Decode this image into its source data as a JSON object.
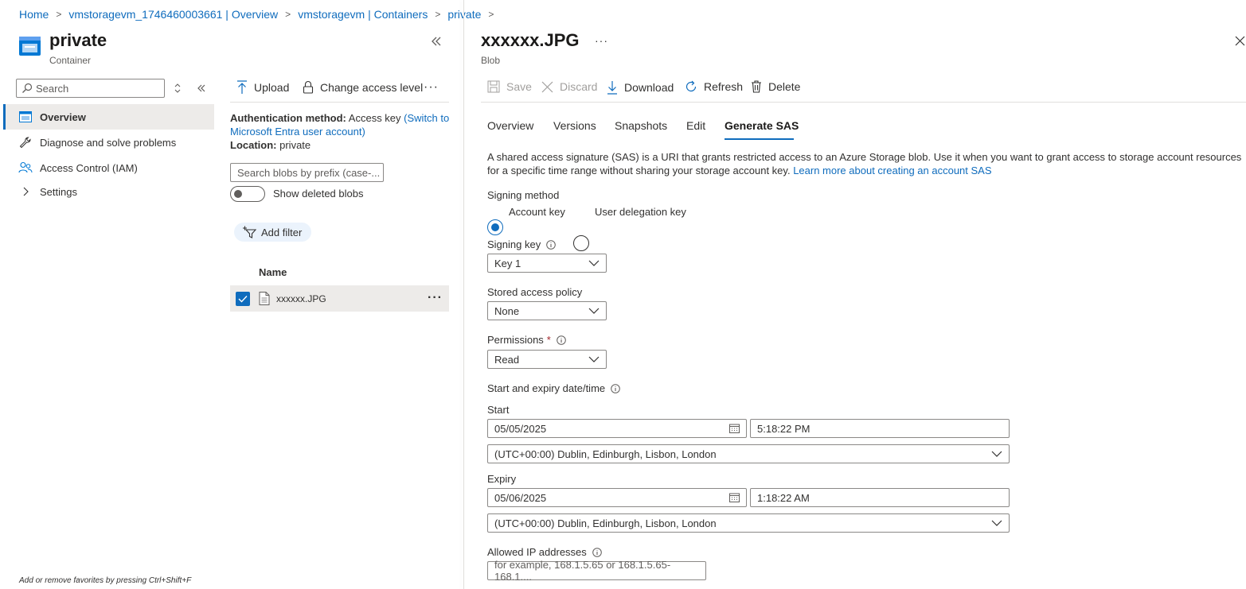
{
  "breadcrumb": [
    "Home",
    "vmstoragevm_1746460003661 | Overview",
    "vmstoragevm | Containers",
    "private"
  ],
  "left": {
    "title": "private",
    "subtitle": "Container",
    "search_placeholder": "Search",
    "nav": [
      {
        "label": "Overview",
        "icon": "overview-icon"
      },
      {
        "label": "Diagnose and solve problems",
        "icon": "wrench-icon"
      },
      {
        "label": "Access Control (IAM)",
        "icon": "people-icon"
      },
      {
        "label": "Settings",
        "icon": "chevron-right-icon"
      }
    ],
    "fav_hint": "Add or remove favorites by pressing Ctrl+Shift+F"
  },
  "middle": {
    "upload_label": "Upload",
    "change_access_label": "Change access level",
    "auth_label": "Authentication method:",
    "auth_value": "Access key",
    "auth_link": "(Switch to Microsoft Entra user account)",
    "location_label": "Location:",
    "location_value": "private",
    "blob_search_placeholder": "Search blobs by prefix (case-...",
    "show_deleted_label": "Show deleted blobs",
    "add_filter_label": "Add filter",
    "column_name": "Name",
    "rows": [
      {
        "name": "xxxxxx.JPG",
        "selected": true
      }
    ]
  },
  "right": {
    "title": "xxxxxx.JPG",
    "subtitle": "Blob",
    "toolbar": {
      "save": "Save",
      "discard": "Discard",
      "download": "Download",
      "refresh": "Refresh",
      "delete": "Delete"
    },
    "tabs": [
      "Overview",
      "Versions",
      "Snapshots",
      "Edit",
      "Generate SAS"
    ],
    "active_tab": "Generate SAS",
    "description": "A shared access signature (SAS) is a URI that grants restricted access to an Azure Storage blob. Use it when you want to grant access to storage account resources for a specific time range without sharing your storage account key.",
    "learn_more": "Learn more about creating an account SAS",
    "signing_method_label": "Signing method",
    "signing_methods": [
      "Account key",
      "User delegation key"
    ],
    "signing_method_selected": "Account key",
    "signing_key_label": "Signing key",
    "signing_key_value": "Key 1",
    "stored_policy_label": "Stored access policy",
    "stored_policy_value": "None",
    "permissions_label": "Permissions",
    "permissions_required": "*",
    "permissions_value": "Read",
    "start_expiry_label": "Start and expiry date/time",
    "start_label": "Start",
    "start_date": "05/05/2025",
    "start_time": "5:18:22 PM",
    "start_tz": "(UTC+00:00) Dublin, Edinburgh, Lisbon, London",
    "expiry_label": "Expiry",
    "expiry_date": "05/06/2025",
    "expiry_time": "1:18:22 AM",
    "expiry_tz": "(UTC+00:00) Dublin, Edinburgh, Lisbon, London",
    "allowed_ip_label": "Allowed IP addresses",
    "allowed_ip_placeholder": "for example, 168.1.5.65 or 168.1.5.65-168.1...."
  },
  "colors": {
    "accent": "#0f6cbd",
    "required": "#a4262c"
  }
}
